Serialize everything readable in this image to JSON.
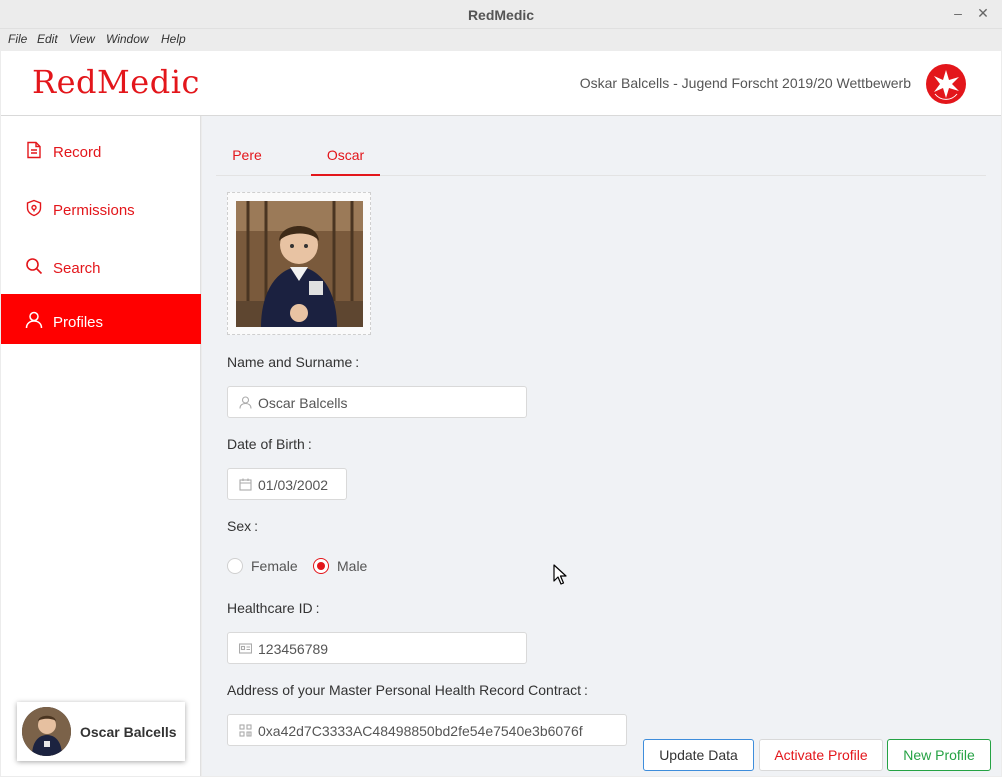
{
  "window": {
    "title": "RedMedic",
    "minimize_glyph": "–",
    "close_glyph": "✕"
  },
  "menu": [
    "File",
    "Edit",
    "View",
    "Window",
    "Help"
  ],
  "header": {
    "logo": "RedMedic",
    "subtitle": "Oskar Balcells - Jugend Forscht 2019/20 Wettbewerb",
    "badge_icon": "jugend-forscht-logo-icon"
  },
  "sidebar": {
    "items": [
      {
        "label": "Record",
        "icon": "document-icon",
        "active": false
      },
      {
        "label": "Permissions",
        "icon": "shield-icon",
        "active": false
      },
      {
        "label": "Search",
        "icon": "search-icon",
        "active": false
      },
      {
        "label": "Profiles",
        "icon": "user-icon",
        "active": true
      }
    ],
    "user": {
      "name": "Oscar Balcells"
    }
  },
  "tabs": [
    {
      "label": "Pere",
      "active": false
    },
    {
      "label": "Oscar",
      "active": true
    }
  ],
  "form": {
    "name": {
      "label": "Name and Surname",
      "value": "Oscar Balcells",
      "icon": "user-icon"
    },
    "dob": {
      "label": "Date of Birth",
      "value": "01/03/2002",
      "icon": "calendar-icon"
    },
    "sex": {
      "label": "Sex",
      "options": [
        "Female",
        "Male"
      ],
      "selected": "Male"
    },
    "healthcare": {
      "label": "Healthcare ID",
      "value": "123456789",
      "icon": "id-card-icon"
    },
    "address": {
      "label": "Address of your Master Personal Health Record Contract",
      "value": "0xa42d7C3333AC48498850bd2fe54e7540e3b6076f",
      "icon": "qrcode-icon"
    },
    "colon": ":"
  },
  "buttons": {
    "update": "Update Data",
    "activate": "Activate Profile",
    "new": "New Profile"
  },
  "colors": {
    "accent": "#e3161b",
    "active_nav": "#ff0000",
    "primary_border": "#3e8ddb",
    "success": "#25a244"
  }
}
